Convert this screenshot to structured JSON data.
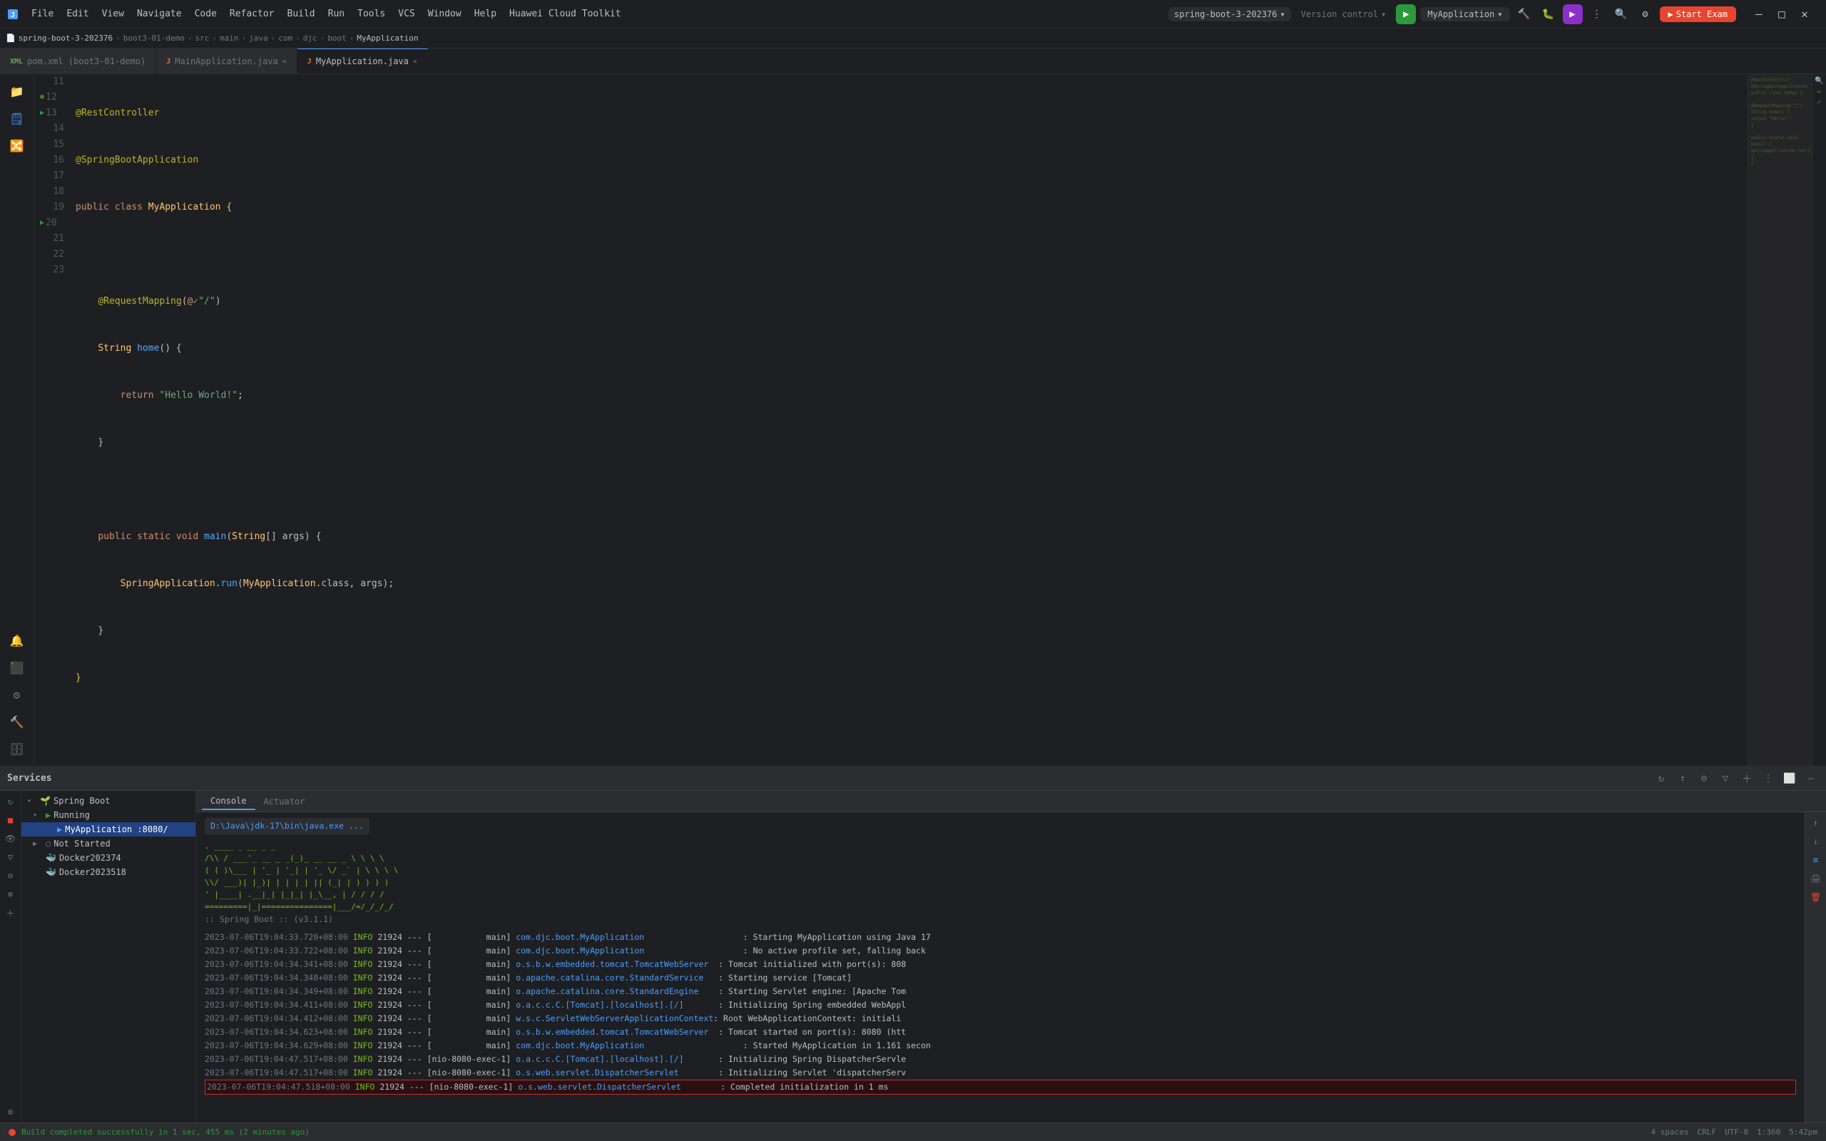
{
  "titleBar": {
    "appIcon": "🔷",
    "menus": [
      "File",
      "Edit",
      "View",
      "Navigate",
      "Code",
      "Refactor",
      "Build",
      "Run",
      "Tools",
      "VCS",
      "Window",
      "Help",
      "Huawei Cloud Toolkit"
    ],
    "projectName": "spring-boot-3-202376",
    "versionControl": "Version control",
    "runConfig": "MyApplication",
    "startExamLabel": "Start Exam",
    "windowControls": {
      "minimize": "—",
      "maximize": "□",
      "close": "✕"
    }
  },
  "breadcrumb": {
    "parts": [
      "spring-boot-3-202376",
      "boot3-01-demo",
      "src",
      "main",
      "java",
      "com",
      "djc",
      "boot",
      "MyApplication"
    ]
  },
  "tabs": [
    {
      "name": "pom.xml",
      "label": "pom.xml (boot3-01-demo)",
      "icon": "xml",
      "active": false
    },
    {
      "name": "MainApplication.java",
      "label": "MainApplication.java",
      "icon": "java",
      "active": false
    },
    {
      "name": "MyApplication.java",
      "label": "MyApplication.java",
      "icon": "java",
      "active": true
    }
  ],
  "codeLines": [
    {
      "num": 11,
      "content": "@RestController"
    },
    {
      "num": 12,
      "content": "@SpringBootApplication"
    },
    {
      "num": 13,
      "content": "public class MyApplication {"
    },
    {
      "num": 14,
      "content": ""
    },
    {
      "num": 15,
      "content": "    @RequestMapping(@\"/\")"
    },
    {
      "num": 16,
      "content": "    String home() {"
    },
    {
      "num": 17,
      "content": "        return \"Hello World!\";"
    },
    {
      "num": 18,
      "content": "    }"
    },
    {
      "num": 19,
      "content": ""
    },
    {
      "num": 20,
      "content": "    public static void main(String[] args) {"
    },
    {
      "num": 21,
      "content": "        SpringApplication.run(MyApplication.class, args);"
    },
    {
      "num": 22,
      "content": "    }"
    },
    {
      "num": 23,
      "content": "}"
    }
  ],
  "servicesPanel": {
    "title": "Services",
    "tree": [
      {
        "level": 0,
        "label": "Spring Boot",
        "icon": "spring",
        "expanded": true
      },
      {
        "level": 1,
        "label": "Running",
        "icon": "running",
        "expanded": true
      },
      {
        "level": 2,
        "label": "MyApplication :8080/",
        "icon": "app",
        "selected": true
      },
      {
        "level": 1,
        "label": "Not Started",
        "icon": "not-started",
        "expanded": true
      },
      {
        "level": 1,
        "label": "Docker202374",
        "icon": "docker"
      },
      {
        "level": 1,
        "label": "Docker2023518",
        "icon": "docker"
      }
    ]
  },
  "consoleTabs": [
    "Console",
    "Actuator"
  ],
  "activeConsoleTab": "Console",
  "consolePath": "D:\\Java\\jdk-17\\bin\\java.exe ...",
  "springAscii": [
    "  .   ____          _            __ _ _",
    " /\\\\ / ___'_ __ _ _(_)_ __  __ _ \\ \\ \\ \\",
    "( ( )\\___ | '_ | '_| | '_ \\/ _` | \\ \\ \\ \\",
    " \\\\/  ___)| |_)| | | | | || (_| |  ) ) ) )",
    "  '  |____| .__|_| |_|_| |_\\__, | / / / /",
    " =========|_|===============|___/=/_/_/_/"
  ],
  "springVersion": ":: Spring Boot ::        (v3.1.1)",
  "consoleLogs": [
    {
      "timestamp": "2023-07-06T19:04:33.720+08:00",
      "level": "INFO",
      "pid": "21924",
      "sep": "---",
      "thread": "[           main]",
      "logger": "com.djc.boot.MyApplication",
      "message": ": Starting MyApplication using Java 17",
      "highlighted": false
    },
    {
      "timestamp": "2023-07-06T19:04:33.722+08:00",
      "level": "INFO",
      "pid": "21924",
      "sep": "---",
      "thread": "[           main]",
      "logger": "com.djc.boot.MyApplication",
      "message": ": No active profile set, falling back",
      "highlighted": false
    },
    {
      "timestamp": "2023-07-06T19:04:34.341+08:00",
      "level": "INFO",
      "pid": "21924",
      "sep": "---",
      "thread": "[           main]",
      "logger": "o.s.b.w.embedded.tomcat.TomcatWebServer",
      "message": ": Tomcat initialized with port(s): 808",
      "highlighted": false
    },
    {
      "timestamp": "2023-07-06T19:04:34.348+08:00",
      "level": "INFO",
      "pid": "21924",
      "sep": "---",
      "thread": "[           main]",
      "logger": "o.apache.catalina.core.StandardService",
      "message": ": Starting service [Tomcat]",
      "highlighted": false
    },
    {
      "timestamp": "2023-07-06T19:04:34.349+08:00",
      "level": "INFO",
      "pid": "21924",
      "sep": "---",
      "thread": "[           main]",
      "logger": "o.apache.catalina.core.StandardEngine",
      "message": ": Starting Servlet engine: [Apache Tom",
      "highlighted": false
    },
    {
      "timestamp": "2023-07-06T19:04:34.411+08:00",
      "level": "INFO",
      "pid": "21924",
      "sep": "---",
      "thread": "[           main]",
      "logger": "o.a.c.c.C.[Tomcat].[localhost].[/]",
      "message": ": Initializing Spring embedded WebAppl",
      "highlighted": false
    },
    {
      "timestamp": "2023-07-06T19:04:34.412+08:00",
      "level": "INFO",
      "pid": "21924",
      "sep": "---",
      "thread": "[           main]",
      "logger": "w.s.c.ServletWebServerApplicationContext",
      "message": ": Root WebApplicationContext: initiali",
      "highlighted": false
    },
    {
      "timestamp": "2023-07-06T19:04:34.623+08:00",
      "level": "INFO",
      "pid": "21924",
      "sep": "---",
      "thread": "[           main]",
      "logger": "o.s.b.w.embedded.tomcat.TomcatWebServer",
      "message": ": Tomcat started on port(s): 8080 (htt",
      "highlighted": false
    },
    {
      "timestamp": "2023-07-06T19:04:34.629+08:00",
      "level": "INFO",
      "pid": "21924",
      "sep": "---",
      "thread": "[           main]",
      "logger": "com.djc.boot.MyApplication",
      "message": ": Started MyApplication in 1.161 secon",
      "highlighted": false
    },
    {
      "timestamp": "2023-07-06T19:04:47.517+08:00",
      "level": "INFO",
      "pid": "21924",
      "sep": "---",
      "thread": "[nio-8080-exec-1]",
      "logger": "o.a.c.c.C.[Tomcat].[localhost].[/]",
      "message": ": Initializing Spring DispatcherServle",
      "highlighted": false
    },
    {
      "timestamp": "2023-07-06T19:04:47.517+08:00",
      "level": "INFO",
      "pid": "21924",
      "sep": "---",
      "thread": "[nio-8080-exec-1]",
      "logger": "o.s.web.servlet.DispatcherServlet",
      "message": ": Initializing Servlet 'dispatcherServ",
      "highlighted": false
    },
    {
      "timestamp": "2023-07-06T19:04:47.518+08:00",
      "level": "INFO",
      "pid": "21924",
      "sep": "---",
      "thread": "[nio-8080-exec-1]",
      "logger": "o.s.web.servlet.DispatcherServlet",
      "message": ": Completed initialization in 1 ms",
      "highlighted": true
    }
  ],
  "statusBar": {
    "message": "Build completed successfully in 1 sec, 455 ms (2 minutes ago)",
    "spaces": "4 spaces",
    "lineEnding": "CRLF",
    "encoding": "UTF-8",
    "position": "1:360",
    "time": "5:42pm"
  }
}
